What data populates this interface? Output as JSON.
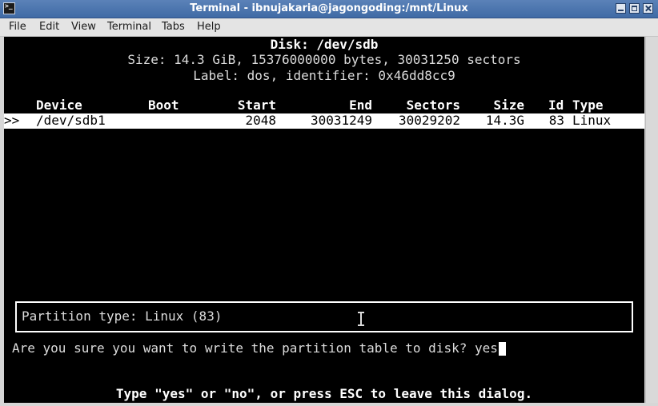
{
  "window": {
    "title": "Terminal - ibnujakaria@jagongoding:/mnt/Linux"
  },
  "menu": [
    "File",
    "Edit",
    "View",
    "Terminal",
    "Tabs",
    "Help"
  ],
  "disk": {
    "heading": "Disk: /dev/sdb",
    "size_line": "Size: 14.3 GiB, 15376000000 bytes, 30031250 sectors",
    "label_line": "Label: dos, identifier: 0x46dd8cc9"
  },
  "table": {
    "headers": {
      "device": "Device",
      "boot": "Boot",
      "start": "Start",
      "end": "End",
      "sectors": "Sectors",
      "size": "Size",
      "id": "Id",
      "type": "Type"
    },
    "rows": [
      {
        "marker": ">>",
        "device": "/dev/sdb1",
        "boot": "",
        "start": "2048",
        "end": "30031249",
        "sectors": "30029202",
        "size": "14.3G",
        "id": "83",
        "type": "Linux"
      }
    ]
  },
  "dialog": {
    "partition_type": "Partition type: Linux (83)",
    "question": "Are you sure you want to write the partition table to disk? yes",
    "hint": "Type \"yes\" or \"no\", or press ESC to leave this dialog."
  }
}
